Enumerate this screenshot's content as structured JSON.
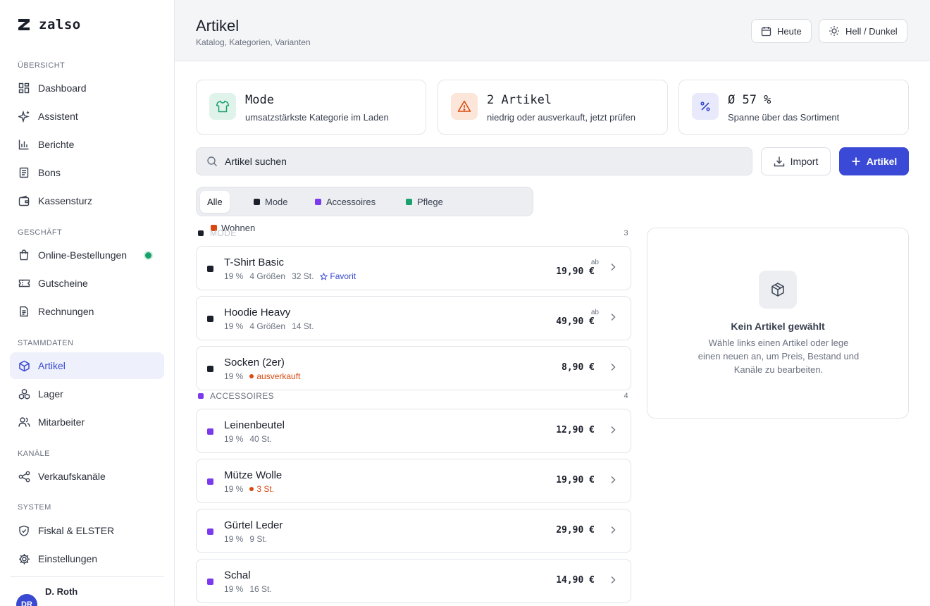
{
  "app": {
    "name": "zalso"
  },
  "sidebar": {
    "sections": {
      "overview": "ÜBERSICHT",
      "business": "GESCHÄFT",
      "master": "STAMMDATEN",
      "channels": "KANÄLE",
      "system": "SYSTEM"
    },
    "items": [
      {
        "label": "Dashboard",
        "icon": "grid-icon"
      },
      {
        "label": "Assistent",
        "icon": "sparkle-icon"
      },
      {
        "label": "Berichte",
        "icon": "bar-chart-icon"
      },
      {
        "label": "Bons",
        "icon": "receipt-icon"
      },
      {
        "label": "Kassensturz",
        "icon": "wallet-icon"
      },
      {
        "label": "Online-Bestellungen",
        "icon": "shopping-bag-icon"
      },
      {
        "label": "Gutscheine",
        "icon": "ticket-icon"
      },
      {
        "label": "Rechnungen",
        "icon": "document-icon"
      },
      {
        "label": "Artikel",
        "icon": "box-icon"
      },
      {
        "label": "Lager",
        "icon": "boxes-icon"
      },
      {
        "label": "Mitarbeiter",
        "icon": "users-icon"
      },
      {
        "label": "Verkaufskanäle",
        "icon": "share-icon"
      },
      {
        "label": "Fiskal & ELSTER",
        "icon": "shield-icon"
      },
      {
        "label": "Einstellungen",
        "icon": "gear-icon"
      }
    ],
    "active": "Artikel",
    "user": {
      "name": "D. Roth",
      "initials": "DR"
    }
  },
  "header": {
    "title": "Artikel",
    "subtitle": "Katalog, Kategorien, Varianten",
    "today_label": "Heute",
    "theme_label": "Hell / Dunkel"
  },
  "stats": [
    {
      "value": "Mode",
      "desc": "umsatzstärkste Kategorie im Laden",
      "color": "#1aa06d"
    },
    {
      "value": "2 Artikel",
      "desc": "niedrig oder ausverkauft, jetzt prüfen",
      "color": "#d9480f"
    },
    {
      "value": "Ø 57 %",
      "desc": "Spanne über das Sortiment",
      "color": "#3949d1"
    }
  ],
  "search": {
    "placeholder": "Artikel suchen"
  },
  "actions": {
    "import": "Import",
    "add": "Artikel"
  },
  "tabs": [
    {
      "label": "Alle",
      "color": ""
    },
    {
      "label": "Mode",
      "color": "#1b1f2a"
    },
    {
      "label": "Accessoires",
      "color": "#7c3aed"
    },
    {
      "label": "Pflege",
      "color": "#1aa06d"
    },
    {
      "label": "Wohnen",
      "color": "#d9480f"
    }
  ],
  "groups": [
    {
      "name": "MODE",
      "count": "3",
      "color": "#1b1f2a",
      "items": [
        {
          "name": "T-Shirt Basic",
          "tax": "19 %",
          "variants": "4 Größen",
          "stock": "32 St.",
          "badge": "Favorit",
          "ab": "ab",
          "price": "19,90 €"
        },
        {
          "name": "Hoodie Heavy",
          "tax": "19 %",
          "variants": "4 Größen",
          "stock": "14 St.",
          "ab": "ab",
          "price": "49,90 €"
        },
        {
          "name": "Socken (2er)",
          "tax": "19 %",
          "warning": "ausverkauft",
          "price": "8,90 €"
        }
      ]
    },
    {
      "name": "ACCESSOIRES",
      "count": "4",
      "color": "#7c3aed",
      "items": [
        {
          "name": "Leinenbeutel",
          "tax": "19 %",
          "stock": "40 St.",
          "price": "12,90 €"
        },
        {
          "name": "Mütze Wolle",
          "tax": "19 %",
          "warning": "3 St.",
          "price": "19,90 €"
        },
        {
          "name": "Gürtel Leder",
          "tax": "19 %",
          "stock": "9 St.",
          "price": "29,90 €"
        },
        {
          "name": "Schal",
          "tax": "19 %",
          "stock": "16 St.",
          "price": "14,90 €"
        }
      ]
    }
  ],
  "empty": {
    "title": "Kein Artikel gewählt",
    "text": "Wähle links einen Artikel oder lege einen neuen an, um Preis, Bestand und Kanäle zu bearbeiten."
  }
}
